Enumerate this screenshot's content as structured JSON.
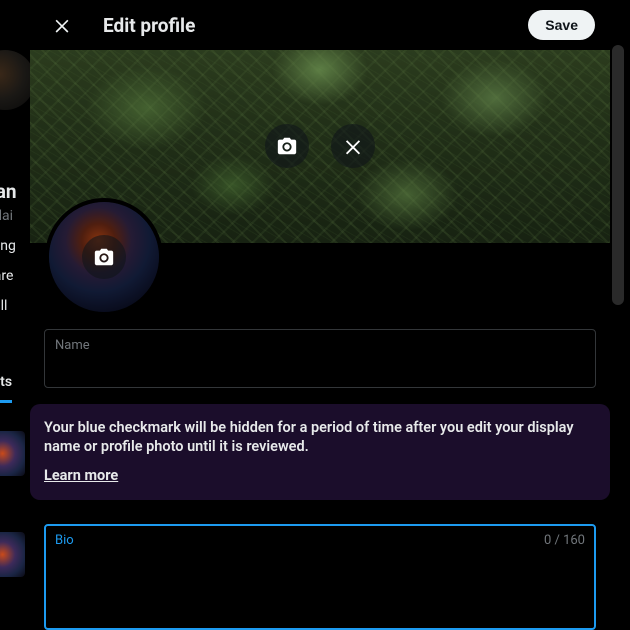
{
  "modal": {
    "title": "Edit profile",
    "save_label": "Save"
  },
  "bg": {
    "name": "dan",
    "handle": "Adai",
    "astrophotography": "sting",
    "location": "Bare",
    "following": "Foll",
    "tab_posts": "osts"
  },
  "fields": {
    "name": {
      "label": "Name",
      "value": ""
    },
    "bio": {
      "label": "Bio",
      "counter": "0 / 160",
      "value": ""
    }
  },
  "notice": {
    "text": "Your blue checkmark will be hidden for a period of time after you edit your display name or profile photo until it is reviewed.",
    "link": "Learn more"
  }
}
